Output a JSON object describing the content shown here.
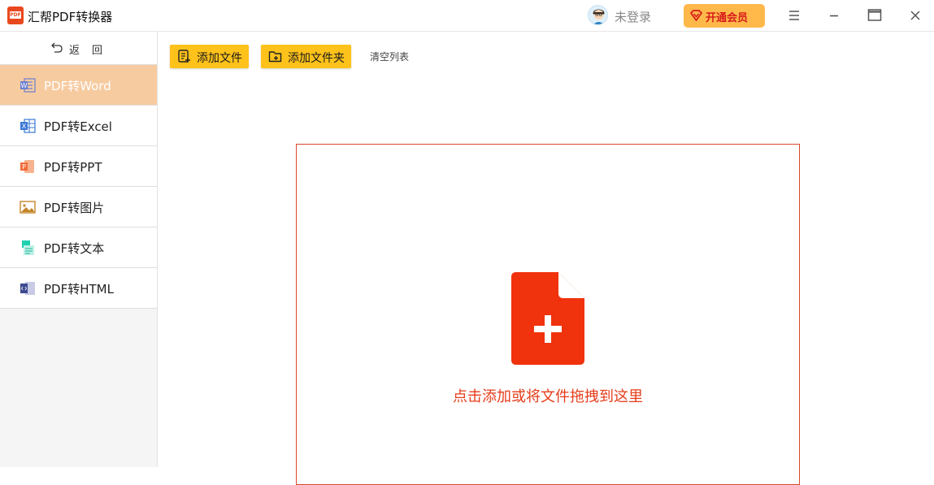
{
  "app": {
    "title": "汇帮PDF转换器",
    "logo_text": "PDF"
  },
  "header": {
    "login_text": "未登录",
    "vip_label": "开通会员"
  },
  "sidebar": {
    "back_label": "返回",
    "items": [
      {
        "label": "PDF转Word",
        "icon": "word-icon",
        "active": true
      },
      {
        "label": "PDF转Excel",
        "icon": "excel-icon",
        "active": false
      },
      {
        "label": "PDF转PPT",
        "icon": "ppt-icon",
        "active": false
      },
      {
        "label": "PDF转图片",
        "icon": "image-icon",
        "active": false
      },
      {
        "label": "PDF转文本",
        "icon": "text-icon",
        "active": false
      },
      {
        "label": "PDF转HTML",
        "icon": "html-icon",
        "active": false
      }
    ]
  },
  "toolbar": {
    "add_file_label": "添加文件",
    "add_folder_label": "添加文件夹",
    "clear_label": "清空列表"
  },
  "dropzone": {
    "hint": "点击添加或将文件拖拽到这里"
  },
  "colors": {
    "accent": "#ffc21a",
    "active_nav": "#f7cba0",
    "drop_red": "#e63c1a",
    "icon_red": "#f0320d",
    "vip_bg": "#ffb84a"
  }
}
